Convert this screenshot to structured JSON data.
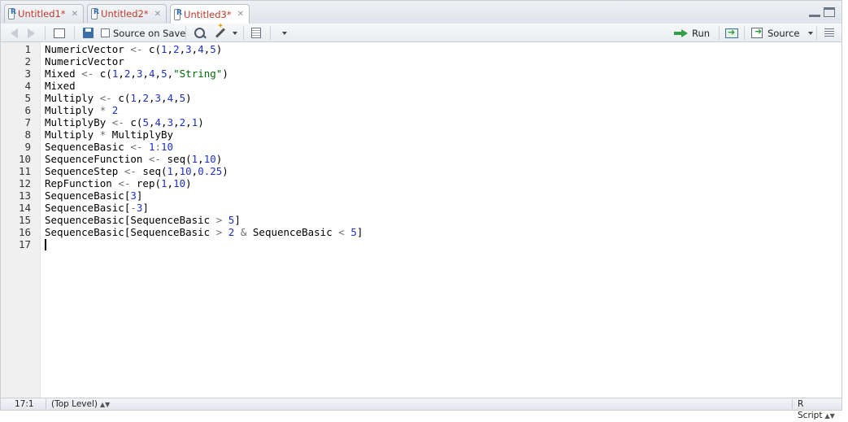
{
  "tabs": [
    {
      "label": "Untitled1*",
      "active": false
    },
    {
      "label": "Untitled2*",
      "active": false
    },
    {
      "label": "Untitled3*",
      "active": true
    }
  ],
  "toolbar": {
    "source_on_save_label": "Source on Save",
    "run_label": "Run",
    "source_label": "Source"
  },
  "icons": {
    "back": "arrow-left-icon",
    "forward": "arrow-right-icon",
    "show_in_window": "show-in-window-icon",
    "save": "save-icon",
    "search": "search-icon",
    "code_tools": "magic-wand-icon",
    "compile_report": "notebook-icon",
    "rerun": "rerun-icon",
    "outline": "outline-icon"
  },
  "editor": {
    "lines": [
      {
        "n": "1",
        "tokens": [
          [
            "id",
            "NumericVector"
          ],
          [
            "op",
            " <- "
          ],
          [
            "id",
            "c("
          ],
          [
            "num",
            "1"
          ],
          [
            "id",
            ","
          ],
          [
            "num",
            "2"
          ],
          [
            "id",
            ","
          ],
          [
            "num",
            "3"
          ],
          [
            "id",
            ","
          ],
          [
            "num",
            "4"
          ],
          [
            "id",
            ","
          ],
          [
            "num",
            "5"
          ],
          [
            "id",
            ")"
          ]
        ]
      },
      {
        "n": "2",
        "tokens": [
          [
            "id",
            "NumericVector"
          ]
        ]
      },
      {
        "n": "3",
        "tokens": [
          [
            "id",
            "Mixed"
          ],
          [
            "op",
            " <- "
          ],
          [
            "id",
            "c("
          ],
          [
            "num",
            "1"
          ],
          [
            "id",
            ","
          ],
          [
            "num",
            "2"
          ],
          [
            "id",
            ","
          ],
          [
            "num",
            "3"
          ],
          [
            "id",
            ","
          ],
          [
            "num",
            "4"
          ],
          [
            "id",
            ","
          ],
          [
            "num",
            "5"
          ],
          [
            "id",
            ","
          ],
          [
            "str",
            "\"String\""
          ],
          [
            "id",
            ")"
          ]
        ]
      },
      {
        "n": "4",
        "tokens": [
          [
            "id",
            "Mixed"
          ]
        ]
      },
      {
        "n": "5",
        "tokens": [
          [
            "id",
            "Multiply"
          ],
          [
            "op",
            " <- "
          ],
          [
            "id",
            "c("
          ],
          [
            "num",
            "1"
          ],
          [
            "id",
            ","
          ],
          [
            "num",
            "2"
          ],
          [
            "id",
            ","
          ],
          [
            "num",
            "3"
          ],
          [
            "id",
            ","
          ],
          [
            "num",
            "4"
          ],
          [
            "id",
            ","
          ],
          [
            "num",
            "5"
          ],
          [
            "id",
            ")"
          ]
        ]
      },
      {
        "n": "6",
        "tokens": [
          [
            "id",
            "Multiply"
          ],
          [
            "op",
            " * "
          ],
          [
            "num",
            "2"
          ]
        ]
      },
      {
        "n": "7",
        "tokens": [
          [
            "id",
            "MultiplyBy"
          ],
          [
            "op",
            " <- "
          ],
          [
            "id",
            "c("
          ],
          [
            "num",
            "5"
          ],
          [
            "id",
            ","
          ],
          [
            "num",
            "4"
          ],
          [
            "id",
            ","
          ],
          [
            "num",
            "3"
          ],
          [
            "id",
            ","
          ],
          [
            "num",
            "2"
          ],
          [
            "id",
            ","
          ],
          [
            "num",
            "1"
          ],
          [
            "id",
            ")"
          ]
        ]
      },
      {
        "n": "8",
        "tokens": [
          [
            "id",
            "Multiply"
          ],
          [
            "op",
            " * "
          ],
          [
            "id",
            "MultiplyBy"
          ]
        ]
      },
      {
        "n": "9",
        "tokens": [
          [
            "id",
            "SequenceBasic"
          ],
          [
            "op",
            " <- "
          ],
          [
            "num",
            "1"
          ],
          [
            "op",
            ":"
          ],
          [
            "num",
            "10"
          ]
        ]
      },
      {
        "n": "10",
        "tokens": [
          [
            "id",
            "SequenceFunction"
          ],
          [
            "op",
            " <- "
          ],
          [
            "id",
            "seq("
          ],
          [
            "num",
            "1"
          ],
          [
            "id",
            ","
          ],
          [
            "num",
            "10"
          ],
          [
            "id",
            ")"
          ]
        ]
      },
      {
        "n": "11",
        "tokens": [
          [
            "id",
            "SequenceStep"
          ],
          [
            "op",
            " <- "
          ],
          [
            "id",
            "seq("
          ],
          [
            "num",
            "1"
          ],
          [
            "id",
            ","
          ],
          [
            "num",
            "10"
          ],
          [
            "id",
            ","
          ],
          [
            "num",
            "0.25"
          ],
          [
            "id",
            ")"
          ]
        ]
      },
      {
        "n": "12",
        "tokens": [
          [
            "id",
            "RepFunction"
          ],
          [
            "op",
            " <- "
          ],
          [
            "id",
            "rep("
          ],
          [
            "num",
            "1"
          ],
          [
            "id",
            ","
          ],
          [
            "num",
            "10"
          ],
          [
            "id",
            ")"
          ]
        ]
      },
      {
        "n": "13",
        "tokens": [
          [
            "id",
            "SequenceBasic["
          ],
          [
            "num",
            "3"
          ],
          [
            "id",
            "]"
          ]
        ]
      },
      {
        "n": "14",
        "tokens": [
          [
            "id",
            "SequenceBasic["
          ],
          [
            "op",
            "-"
          ],
          [
            "num",
            "3"
          ],
          [
            "id",
            "]"
          ]
        ]
      },
      {
        "n": "15",
        "tokens": [
          [
            "id",
            "SequenceBasic[SequenceBasic"
          ],
          [
            "op",
            " > "
          ],
          [
            "num",
            "5"
          ],
          [
            "id",
            "]"
          ]
        ]
      },
      {
        "n": "16",
        "tokens": [
          [
            "id",
            "SequenceBasic[SequenceBasic"
          ],
          [
            "op",
            " > "
          ],
          [
            "num",
            "2"
          ],
          [
            "op",
            " & "
          ],
          [
            "id",
            "SequenceBasic"
          ],
          [
            "op",
            " < "
          ],
          [
            "num",
            "5"
          ],
          [
            "id",
            "]"
          ]
        ]
      },
      {
        "n": "17",
        "tokens": []
      }
    ]
  },
  "status": {
    "position": "17:1",
    "scope": "(Top Level)",
    "file_type": "R Script"
  },
  "colors": {
    "tab_text": "#c0392b",
    "number": "#1d32c9",
    "string": "#036a07",
    "operator": "#6e6e6e"
  }
}
